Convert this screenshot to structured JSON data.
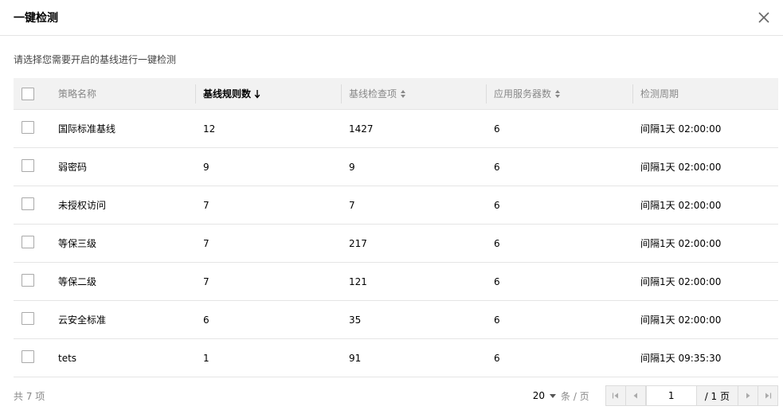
{
  "dialog": {
    "title": "一键检测",
    "description": "请选择您需要开启的基线进行一键检测"
  },
  "table": {
    "columns": [
      {
        "label": "策略名称",
        "sort": "none"
      },
      {
        "label": "基线规则数",
        "sort": "desc-active"
      },
      {
        "label": "基线检查项",
        "sort": "sortable"
      },
      {
        "label": "应用服务器数",
        "sort": "sortable"
      },
      {
        "label": "检测周期",
        "sort": "none"
      }
    ],
    "rows": [
      {
        "name": "国际标准基线",
        "rules": "12",
        "items": "1427",
        "servers": "6",
        "cycle": "间隔1天 02:00:00"
      },
      {
        "name": "弱密码",
        "rules": "9",
        "items": "9",
        "servers": "6",
        "cycle": "间隔1天 02:00:00"
      },
      {
        "name": "未授权访问",
        "rules": "7",
        "items": "7",
        "servers": "6",
        "cycle": "间隔1天 02:00:00"
      },
      {
        "name": "等保三级",
        "rules": "7",
        "items": "217",
        "servers": "6",
        "cycle": "间隔1天 02:00:00"
      },
      {
        "name": "等保二级",
        "rules": "7",
        "items": "121",
        "servers": "6",
        "cycle": "间隔1天 02:00:00"
      },
      {
        "name": "云安全标准",
        "rules": "6",
        "items": "35",
        "servers": "6",
        "cycle": "间隔1天 02:00:00"
      },
      {
        "name": "tets",
        "rules": "1",
        "items": "91",
        "servers": "6",
        "cycle": "间隔1天 09:35:30"
      }
    ]
  },
  "footer": {
    "total": "共 7 项",
    "page_size": "20",
    "page_unit": "条 / 页",
    "current_page": "1",
    "total_pages": "/ 1 页"
  },
  "icons": {
    "close": "close-icon",
    "sort_desc": "arrow-down-icon",
    "sort_both": "sort-icon",
    "first": "first-page-icon",
    "prev": "prev-page-icon",
    "next": "next-page-icon",
    "last": "last-page-icon"
  }
}
